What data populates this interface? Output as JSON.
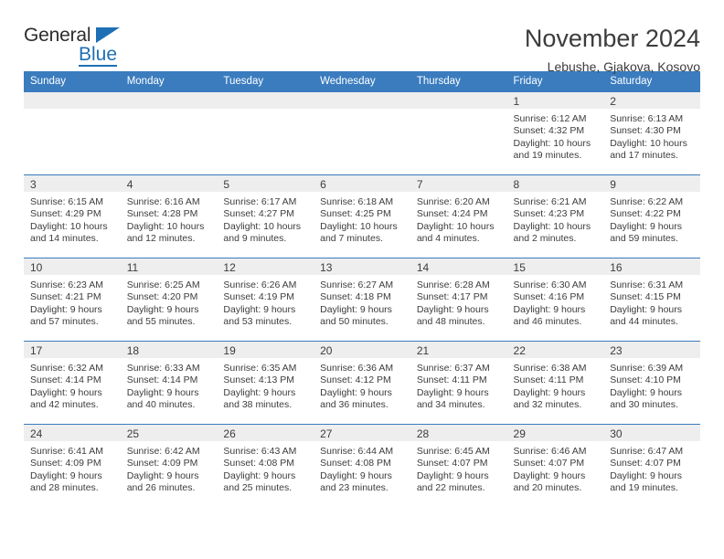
{
  "brand": {
    "line1": "General",
    "line2": "Blue",
    "triangle_color": "#1f6fb5",
    "text_color": "#2d2d2d"
  },
  "header": {
    "title": "November 2024",
    "subtitle": "Lebushe, Gjakova, Kosovo"
  },
  "theme": {
    "header_bar": "#3a7cbe",
    "daynum_band": "#eeeeee",
    "text": "#3c3c3c"
  },
  "weekdays": [
    "Sunday",
    "Monday",
    "Tuesday",
    "Wednesday",
    "Thursday",
    "Friday",
    "Saturday"
  ],
  "weeks": [
    [
      {
        "day": "",
        "empty": true,
        "sunrise": "",
        "sunset": "",
        "daylight1": "",
        "daylight2": ""
      },
      {
        "day": "",
        "empty": true,
        "sunrise": "",
        "sunset": "",
        "daylight1": "",
        "daylight2": ""
      },
      {
        "day": "",
        "empty": true,
        "sunrise": "",
        "sunset": "",
        "daylight1": "",
        "daylight2": ""
      },
      {
        "day": "",
        "empty": true,
        "sunrise": "",
        "sunset": "",
        "daylight1": "",
        "daylight2": ""
      },
      {
        "day": "",
        "empty": true,
        "sunrise": "",
        "sunset": "",
        "daylight1": "",
        "daylight2": ""
      },
      {
        "day": "1",
        "empty": false,
        "sunrise": "Sunrise: 6:12 AM",
        "sunset": "Sunset: 4:32 PM",
        "daylight1": "Daylight: 10 hours",
        "daylight2": "and 19 minutes."
      },
      {
        "day": "2",
        "empty": false,
        "sunrise": "Sunrise: 6:13 AM",
        "sunset": "Sunset: 4:30 PM",
        "daylight1": "Daylight: 10 hours",
        "daylight2": "and 17 minutes."
      }
    ],
    [
      {
        "day": "3",
        "empty": false,
        "sunrise": "Sunrise: 6:15 AM",
        "sunset": "Sunset: 4:29 PM",
        "daylight1": "Daylight: 10 hours",
        "daylight2": "and 14 minutes."
      },
      {
        "day": "4",
        "empty": false,
        "sunrise": "Sunrise: 6:16 AM",
        "sunset": "Sunset: 4:28 PM",
        "daylight1": "Daylight: 10 hours",
        "daylight2": "and 12 minutes."
      },
      {
        "day": "5",
        "empty": false,
        "sunrise": "Sunrise: 6:17 AM",
        "sunset": "Sunset: 4:27 PM",
        "daylight1": "Daylight: 10 hours",
        "daylight2": "and 9 minutes."
      },
      {
        "day": "6",
        "empty": false,
        "sunrise": "Sunrise: 6:18 AM",
        "sunset": "Sunset: 4:25 PM",
        "daylight1": "Daylight: 10 hours",
        "daylight2": "and 7 minutes."
      },
      {
        "day": "7",
        "empty": false,
        "sunrise": "Sunrise: 6:20 AM",
        "sunset": "Sunset: 4:24 PM",
        "daylight1": "Daylight: 10 hours",
        "daylight2": "and 4 minutes."
      },
      {
        "day": "8",
        "empty": false,
        "sunrise": "Sunrise: 6:21 AM",
        "sunset": "Sunset: 4:23 PM",
        "daylight1": "Daylight: 10 hours",
        "daylight2": "and 2 minutes."
      },
      {
        "day": "9",
        "empty": false,
        "sunrise": "Sunrise: 6:22 AM",
        "sunset": "Sunset: 4:22 PM",
        "daylight1": "Daylight: 9 hours",
        "daylight2": "and 59 minutes."
      }
    ],
    [
      {
        "day": "10",
        "empty": false,
        "sunrise": "Sunrise: 6:23 AM",
        "sunset": "Sunset: 4:21 PM",
        "daylight1": "Daylight: 9 hours",
        "daylight2": "and 57 minutes."
      },
      {
        "day": "11",
        "empty": false,
        "sunrise": "Sunrise: 6:25 AM",
        "sunset": "Sunset: 4:20 PM",
        "daylight1": "Daylight: 9 hours",
        "daylight2": "and 55 minutes."
      },
      {
        "day": "12",
        "empty": false,
        "sunrise": "Sunrise: 6:26 AM",
        "sunset": "Sunset: 4:19 PM",
        "daylight1": "Daylight: 9 hours",
        "daylight2": "and 53 minutes."
      },
      {
        "day": "13",
        "empty": false,
        "sunrise": "Sunrise: 6:27 AM",
        "sunset": "Sunset: 4:18 PM",
        "daylight1": "Daylight: 9 hours",
        "daylight2": "and 50 minutes."
      },
      {
        "day": "14",
        "empty": false,
        "sunrise": "Sunrise: 6:28 AM",
        "sunset": "Sunset: 4:17 PM",
        "daylight1": "Daylight: 9 hours",
        "daylight2": "and 48 minutes."
      },
      {
        "day": "15",
        "empty": false,
        "sunrise": "Sunrise: 6:30 AM",
        "sunset": "Sunset: 4:16 PM",
        "daylight1": "Daylight: 9 hours",
        "daylight2": "and 46 minutes."
      },
      {
        "day": "16",
        "empty": false,
        "sunrise": "Sunrise: 6:31 AM",
        "sunset": "Sunset: 4:15 PM",
        "daylight1": "Daylight: 9 hours",
        "daylight2": "and 44 minutes."
      }
    ],
    [
      {
        "day": "17",
        "empty": false,
        "sunrise": "Sunrise: 6:32 AM",
        "sunset": "Sunset: 4:14 PM",
        "daylight1": "Daylight: 9 hours",
        "daylight2": "and 42 minutes."
      },
      {
        "day": "18",
        "empty": false,
        "sunrise": "Sunrise: 6:33 AM",
        "sunset": "Sunset: 4:14 PM",
        "daylight1": "Daylight: 9 hours",
        "daylight2": "and 40 minutes."
      },
      {
        "day": "19",
        "empty": false,
        "sunrise": "Sunrise: 6:35 AM",
        "sunset": "Sunset: 4:13 PM",
        "daylight1": "Daylight: 9 hours",
        "daylight2": "and 38 minutes."
      },
      {
        "day": "20",
        "empty": false,
        "sunrise": "Sunrise: 6:36 AM",
        "sunset": "Sunset: 4:12 PM",
        "daylight1": "Daylight: 9 hours",
        "daylight2": "and 36 minutes."
      },
      {
        "day": "21",
        "empty": false,
        "sunrise": "Sunrise: 6:37 AM",
        "sunset": "Sunset: 4:11 PM",
        "daylight1": "Daylight: 9 hours",
        "daylight2": "and 34 minutes."
      },
      {
        "day": "22",
        "empty": false,
        "sunrise": "Sunrise: 6:38 AM",
        "sunset": "Sunset: 4:11 PM",
        "daylight1": "Daylight: 9 hours",
        "daylight2": "and 32 minutes."
      },
      {
        "day": "23",
        "empty": false,
        "sunrise": "Sunrise: 6:39 AM",
        "sunset": "Sunset: 4:10 PM",
        "daylight1": "Daylight: 9 hours",
        "daylight2": "and 30 minutes."
      }
    ],
    [
      {
        "day": "24",
        "empty": false,
        "sunrise": "Sunrise: 6:41 AM",
        "sunset": "Sunset: 4:09 PM",
        "daylight1": "Daylight: 9 hours",
        "daylight2": "and 28 minutes."
      },
      {
        "day": "25",
        "empty": false,
        "sunrise": "Sunrise: 6:42 AM",
        "sunset": "Sunset: 4:09 PM",
        "daylight1": "Daylight: 9 hours",
        "daylight2": "and 26 minutes."
      },
      {
        "day": "26",
        "empty": false,
        "sunrise": "Sunrise: 6:43 AM",
        "sunset": "Sunset: 4:08 PM",
        "daylight1": "Daylight: 9 hours",
        "daylight2": "and 25 minutes."
      },
      {
        "day": "27",
        "empty": false,
        "sunrise": "Sunrise: 6:44 AM",
        "sunset": "Sunset: 4:08 PM",
        "daylight1": "Daylight: 9 hours",
        "daylight2": "and 23 minutes."
      },
      {
        "day": "28",
        "empty": false,
        "sunrise": "Sunrise: 6:45 AM",
        "sunset": "Sunset: 4:07 PM",
        "daylight1": "Daylight: 9 hours",
        "daylight2": "and 22 minutes."
      },
      {
        "day": "29",
        "empty": false,
        "sunrise": "Sunrise: 6:46 AM",
        "sunset": "Sunset: 4:07 PM",
        "daylight1": "Daylight: 9 hours",
        "daylight2": "and 20 minutes."
      },
      {
        "day": "30",
        "empty": false,
        "sunrise": "Sunrise: 6:47 AM",
        "sunset": "Sunset: 4:07 PM",
        "daylight1": "Daylight: 9 hours",
        "daylight2": "and 19 minutes."
      }
    ]
  ]
}
